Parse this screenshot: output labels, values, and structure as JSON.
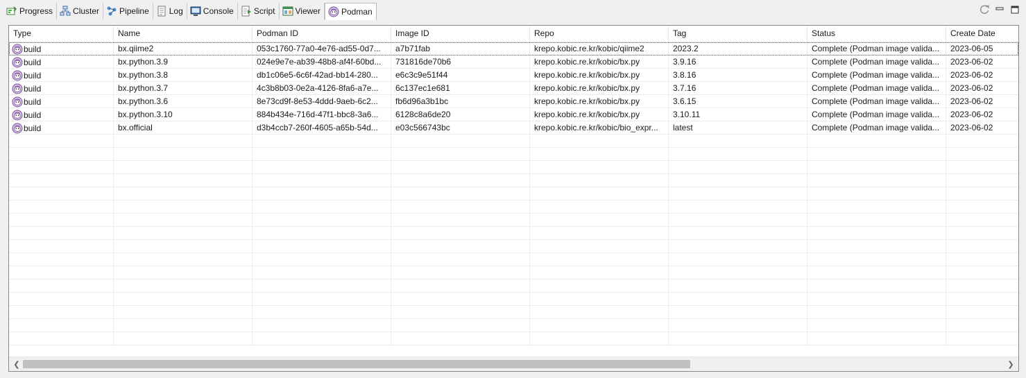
{
  "tabs": [
    {
      "label": "Progress",
      "icon": "progress-icon"
    },
    {
      "label": "Cluster",
      "icon": "cluster-icon"
    },
    {
      "label": "Pipeline",
      "icon": "pipeline-icon"
    },
    {
      "label": "Log",
      "icon": "log-icon"
    },
    {
      "label": "Console",
      "icon": "console-icon"
    },
    {
      "label": "Script",
      "icon": "script-icon"
    },
    {
      "label": "Viewer",
      "icon": "viewer-icon"
    },
    {
      "label": "Podman",
      "icon": "podman-icon",
      "active": true
    }
  ],
  "view_controls": [
    "refresh-icon",
    "minimize-icon",
    "maximize-icon"
  ],
  "table": {
    "columns": [
      "Type",
      "Name",
      "Podman ID",
      "Image ID",
      "Repo",
      "Tag",
      "Status",
      "Create Date"
    ],
    "rows": [
      [
        "build",
        "bx.qiime2",
        "053c1760-77a0-4e76-ad55-0d7...",
        "a7b71fab",
        "krepo.kobic.re.kr/kobic/qiime2",
        "2023.2",
        "Complete (Podman image valida...",
        "2023-06-05"
      ],
      [
        "build",
        "bx.python.3.9",
        "024e9e7e-ab39-48b8-af4f-60bd...",
        "731816de70b6",
        "krepo.kobic.re.kr/kobic/bx.py",
        "3.9.16",
        "Complete (Podman image valida...",
        "2023-06-02"
      ],
      [
        "build",
        "bx.python.3.8",
        "db1c06e5-6c6f-42ad-bb14-280...",
        "e6c3c9e51f44",
        "krepo.kobic.re.kr/kobic/bx.py",
        "3.8.16",
        "Complete (Podman image valida...",
        "2023-06-02"
      ],
      [
        "build",
        "bx.python.3.7",
        "4c3b8b03-0e2a-4126-8fa6-a7e...",
        "6c137ec1e681",
        "krepo.kobic.re.kr/kobic/bx.py",
        "3.7.16",
        "Complete (Podman image valida...",
        "2023-06-02"
      ],
      [
        "build",
        "bx.python.3.6",
        "8e73cd9f-8e53-4ddd-9aeb-6c2...",
        "fb6d96a3b1bc",
        "krepo.kobic.re.kr/kobic/bx.py",
        "3.6.15",
        "Complete (Podman image valida...",
        "2023-06-02"
      ],
      [
        "build",
        "bx.python.3.10",
        "884b434e-716d-47f1-bbc8-3a6...",
        "6128c8a6de20",
        "krepo.kobic.re.kr/kobic/bx.py",
        "3.10.11",
        "Complete (Podman image valida...",
        "2023-06-02"
      ],
      [
        "build",
        "bx.official",
        "d3b4ccb7-260f-4605-a65b-54d...",
        "e03c566743bc",
        "krepo.kobic.re.kr/kobic/bio_expr...",
        "latest",
        "Complete (Podman image valida...",
        "2023-06-02"
      ]
    ],
    "selected_row": 0,
    "empty_rows": 16
  },
  "scrollbar": {
    "thumb_fraction": 0.68
  }
}
